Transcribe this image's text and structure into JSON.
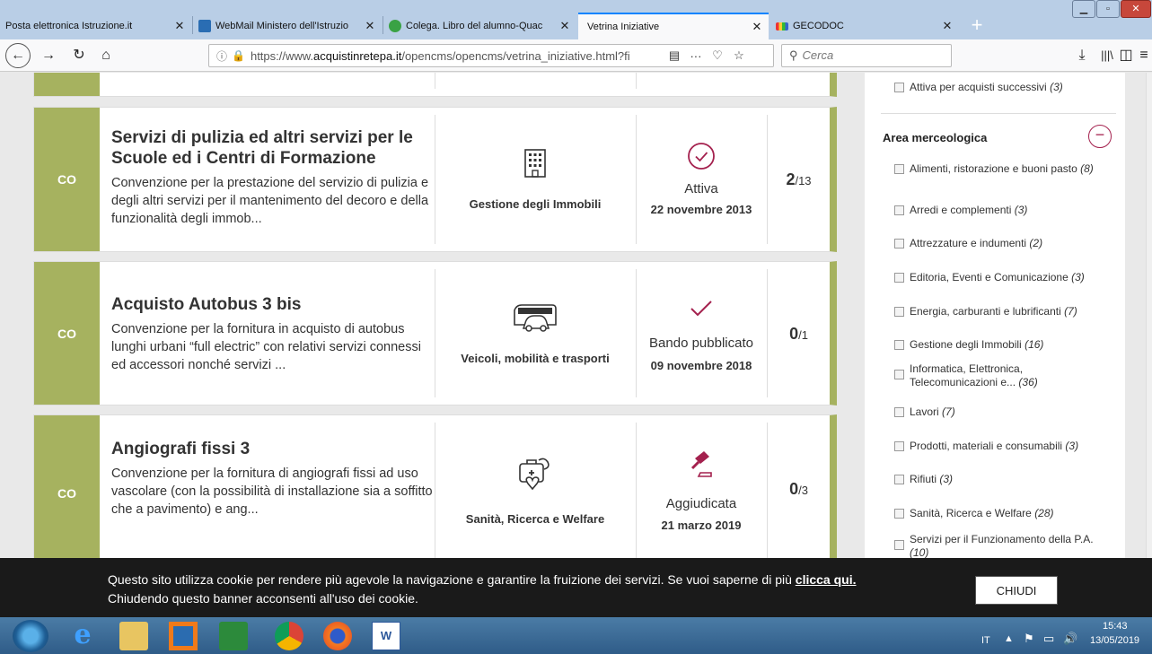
{
  "browser": {
    "tabs": [
      {
        "title": "Posta elettronica Istruzione.it",
        "close": "✕"
      },
      {
        "title": "WebMail Ministero dell'Istruzio",
        "close": "✕"
      },
      {
        "title": "Colega. Libro del alumno-Quac",
        "close": "✕"
      },
      {
        "title": "Vetrina Iniziative",
        "close": "✕"
      },
      {
        "title": "GECODOC",
        "close": "✕"
      }
    ],
    "new_tab": "+",
    "url_prefix": "https://www.",
    "url_domain": "acquistinretepa.it",
    "url_rest": "/opencms/opencms/vetrina_iniziative.html?fi",
    "search_placeholder": "Cerca",
    "reader_icon": "reader-view-icon",
    "more_icon": "···"
  },
  "cards": [
    {
      "badge": "CO",
      "title": "Servizi di pulizia ed altri servizi per le Scuole ed i Centri di Formazione",
      "description": "Convenzione per la prestazione del servizio di pulizia e degli altri servizi per il mantenimento del decoro e della funzionalità degli immob...",
      "category": "Gestione degli Immobili",
      "category_icon": "building-icon",
      "status": "Attiva",
      "status_icon": "check-circle-icon",
      "date": "22 novembre 2013",
      "count_current": "2",
      "count_total": "/13"
    },
    {
      "badge": "CO",
      "title": "Acquisto Autobus 3 bis",
      "description": "Convenzione per la fornitura in acquisto di autobus lunghi urbani “full electric” con relativi servizi connessi ed accessori nonché servizi ...",
      "category": "Veicoli, mobilità e trasporti",
      "category_icon": "bus-icon",
      "status": "Bando pubblicato",
      "status_icon": "check-icon",
      "date": "09 novembre 2018",
      "count_current": "0",
      "count_total": "/1"
    },
    {
      "badge": "CO",
      "title": "Angiografi fissi 3",
      "description": "Convenzione per la fornitura di angiografi fissi ad uso vascolare (con la possibilità di installazione sia a soffitto che a pavimento) e ang...",
      "category": "Sanità, Ricerca e Welfare",
      "category_icon": "health-icon",
      "status": "Aggiudicata",
      "status_icon": "gavel-icon",
      "date": "21 marzo 2019",
      "count_current": "0",
      "count_total": "/3"
    }
  ],
  "sidebar": {
    "top_item": {
      "label": "Attiva per acquisti successivi",
      "count": "(3)"
    },
    "section_title": "Area merceologica",
    "collapse_symbol": "−",
    "items": [
      {
        "label": "Alimenti, ristorazione e buoni pasto",
        "count": "(8)"
      },
      {
        "label": "Arredi e complementi",
        "count": "(3)"
      },
      {
        "label": "Attrezzature e indumenti",
        "count": "(2)"
      },
      {
        "label": "Editoria, Eventi e Comunicazione",
        "count": "(3)"
      },
      {
        "label": "Energia, carburanti e lubrificanti",
        "count": "(7)"
      },
      {
        "label": "Gestione degli Immobili",
        "count": "(16)"
      },
      {
        "label": "Informatica, Elettronica, Telecomunicazioni e...",
        "count": "(36)"
      },
      {
        "label": "Lavori",
        "count": "(7)"
      },
      {
        "label": "Prodotti, materiali e consumabili",
        "count": "(3)"
      },
      {
        "label": "Rifiuti",
        "count": "(3)"
      },
      {
        "label": "Sanità, Ricerca e Welfare",
        "count": "(28)"
      },
      {
        "label": "Servizi per il Funzionamento della P.A.",
        "count": "(10)"
      }
    ]
  },
  "cookie_banner": {
    "text_before": "Questo sito utilizza cookie per rendere più agevole la navigazione e garantire la fruizione dei servizi. Se vuoi saperne di più ",
    "link": "clicca qui.",
    "text_after": "Chiudendo questo banner acconsenti all'uso dei cookie.",
    "button": "CHIUDI"
  },
  "taskbar": {
    "lang": "IT",
    "time": "15:43",
    "date": "13/05/2019"
  },
  "colors": {
    "accent_green": "#a6b25f",
    "accent_magenta": "#a4214e"
  }
}
